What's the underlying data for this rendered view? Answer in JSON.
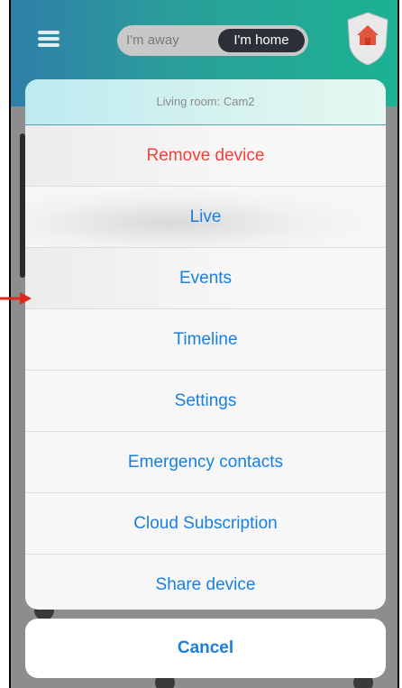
{
  "header": {
    "mode_away_label": "I'm away",
    "mode_home_label": "I'm home",
    "active_mode": "home"
  },
  "action_sheet": {
    "title": "Living room: Cam2",
    "items": [
      {
        "label": "Remove device",
        "style": "destructive"
      },
      {
        "label": "Live"
      },
      {
        "label": "Events"
      },
      {
        "label": "Timeline"
      },
      {
        "label": "Settings"
      },
      {
        "label": "Emergency contacts"
      },
      {
        "label": "Cloud Subscription"
      },
      {
        "label": "Share device"
      }
    ],
    "cancel_label": "Cancel"
  },
  "colors": {
    "action_blue": "#1a7fde",
    "destructive_red": "#f0413a",
    "header_start": "#2f7fa8",
    "header_end": "#1bb292",
    "annotation_arrow": "#e0261d"
  },
  "icons": [
    "hamburger-menu-icon",
    "home-shield-icon",
    "annotation-arrow-icon"
  ]
}
